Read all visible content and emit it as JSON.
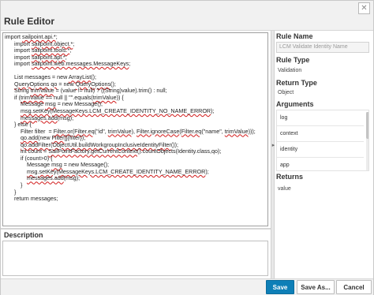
{
  "window": {
    "title": "Rule Editor",
    "close_glyph": "✕"
  },
  "editor": {
    "lines": [
      [
        {
          "t": "import "
        },
        {
          "t": "sailpoint.api.*",
          "err": true
        },
        {
          "t": ";"
        }
      ],
      [
        {
          "t": "      import "
        },
        {
          "t": "sailpoint.object.*",
          "err": true
        },
        {
          "t": ";"
        }
      ],
      [
        {
          "t": "      import "
        },
        {
          "t": "sailpoint.tools.*",
          "err": true
        },
        {
          "t": ";"
        }
      ],
      [
        {
          "t": "      import "
        },
        {
          "t": "sailpoint.api.*",
          "err": true
        },
        {
          "t": ";"
        }
      ],
      [
        {
          "t": "      import "
        },
        {
          "t": "sailpoint.web.messages.MessageKeys",
          "err": true
        },
        {
          "t": ";"
        }
      ],
      [
        {
          "t": ""
        }
      ],
      [
        {
          "t": "      List messages = new "
        },
        {
          "t": "ArrayList",
          "err": true
        },
        {
          "t": "();"
        }
      ],
      [
        {
          "t": "      "
        },
        {
          "t": "QueryOptions",
          "err": true
        },
        {
          "t": " "
        },
        {
          "t": "qo",
          "err": true
        },
        {
          "t": " = new "
        },
        {
          "t": "QueryOptions",
          "err": true
        },
        {
          "t": "();"
        }
      ],
      [
        {
          "t": "      String "
        },
        {
          "t": "trimValue",
          "err": true
        },
        {
          "t": " = (value != null) ? ((String)value).trim() : null;"
        }
      ],
      [
        {
          "t": "      if ("
        },
        {
          "t": "trimValue",
          "err": true
        },
        {
          "t": " == null || \"\".equals("
        },
        {
          "t": "trimValue",
          "err": true
        },
        {
          "t": ")) {"
        }
      ],
      [
        {
          "t": "          Message "
        },
        {
          "t": "msg",
          "err": true
        },
        {
          "t": " = new Message();"
        }
      ],
      [
        {
          "t": "          "
        },
        {
          "t": "msg.setKey",
          "err": true
        },
        {
          "t": "("
        },
        {
          "t": "MessageKeys.LCM_CREATE_IDENTITY_NO_NAME_ERROR",
          "err": true
        },
        {
          "t": ");"
        }
      ],
      [
        {
          "t": "          "
        },
        {
          "t": "messages.add",
          "err": true
        },
        {
          "t": "(msg);"
        }
      ],
      [
        {
          "t": "      } else {"
        }
      ],
      [
        {
          "t": "          Filter filter  = "
        },
        {
          "t": "Filter.or",
          "err": true
        },
        {
          "t": "("
        },
        {
          "t": "Filter.eq",
          "err": true
        },
        {
          "t": "(\"id\", "
        },
        {
          "t": "trimValue",
          "err": true
        },
        {
          "t": "), "
        },
        {
          "t": "Filter.ignoreCase",
          "err": true
        },
        {
          "t": "("
        },
        {
          "t": "Filter.eq",
          "err": true
        },
        {
          "t": "(\"name\", "
        },
        {
          "t": "trimValue",
          "err": true
        },
        {
          "t": ")));"
        }
      ],
      [
        {
          "t": "          "
        },
        {
          "t": "qo.add",
          "err": true
        },
        {
          "t": "(new "
        },
        {
          "t": "Filter",
          "err": true
        },
        {
          "t": "[]{filter});"
        }
      ],
      [
        {
          "t": "          "
        },
        {
          "t": "qo.addFilter",
          "err": true
        },
        {
          "t": "("
        },
        {
          "t": "ObjectUtil.buildWorkgroupInclusiveIdentityFilter",
          "err": true
        },
        {
          "t": "());"
        }
      ],
      [
        {
          "t": "          int count = "
        },
        {
          "t": "SailPointFactory.getCurrentContext",
          "err": true
        },
        {
          "t": "().countObjects(Identity.class,qo);"
        }
      ],
      [
        {
          "t": "          if (count>0) {"
        }
      ],
      [
        {
          "t": "              Message "
        },
        {
          "t": "msg",
          "err": true
        },
        {
          "t": " = new Message();"
        }
      ],
      [
        {
          "t": "              "
        },
        {
          "t": "msg.setKey",
          "err": true
        },
        {
          "t": "("
        },
        {
          "t": "MessageKeys.LCM_CREATE_IDENTITY_NAME_ERROR",
          "err": true
        },
        {
          "t": ");"
        }
      ],
      [
        {
          "t": "              "
        },
        {
          "t": "messages.add",
          "err": true
        },
        {
          "t": "(msg);"
        }
      ],
      [
        {
          "t": "          }"
        }
      ],
      [
        {
          "t": "      }"
        }
      ],
      [
        {
          "t": "      return messages;"
        }
      ]
    ]
  },
  "description": {
    "label": "Description",
    "value": ""
  },
  "properties": {
    "rule_name_label": "Rule Name",
    "rule_name_value": "LCM Validate Identity Name",
    "rule_type_label": "Rule Type",
    "rule_type_value": "Validation",
    "return_type_label": "Return Type",
    "return_type_value": "Object",
    "arguments_label": "Arguments",
    "arguments": [
      "log",
      "context",
      "identity",
      "app"
    ],
    "returns_label": "Returns",
    "returns": [
      "value"
    ]
  },
  "footer": {
    "save_label": "Save",
    "save_as_label": "Save As...",
    "cancel_label": "Cancel"
  },
  "colors": {
    "primary_button": "#0e7fb7",
    "spell_error": "#d11a1a"
  },
  "icons": {
    "close": "close-icon",
    "splitter": "chevron-right-icon"
  }
}
